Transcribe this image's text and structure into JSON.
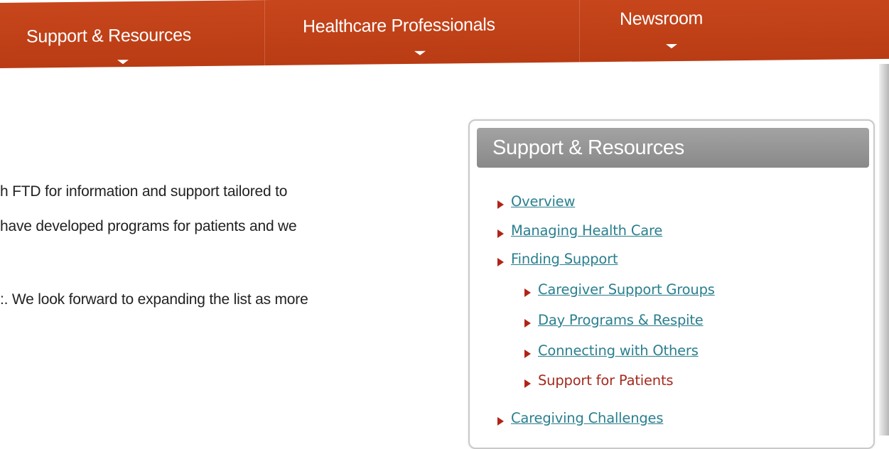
{
  "nav": {
    "items": [
      {
        "label": "Support & Resources"
      },
      {
        "label": "Healthcare Professionals"
      },
      {
        "label": "Newsroom"
      }
    ]
  },
  "content": {
    "lines": [
      "h FTD for information and support tailored to",
      "have developed programs for patients and we",
      ":.  We look forward to expanding the list as more"
    ]
  },
  "sidebar": {
    "title": "Support & Resources",
    "links": [
      {
        "label": "Overview"
      },
      {
        "label": "Managing Health Care"
      },
      {
        "label": "Finding Support"
      },
      {
        "label": "Caregiver Support Groups"
      },
      {
        "label": "Day Programs & Respite"
      },
      {
        "label": "Connecting with Others"
      },
      {
        "label": "Support for Patients"
      },
      {
        "label": "Caregiving Challenges"
      }
    ]
  },
  "colors": {
    "nav_background": "#c0421a",
    "link": "#2a7f8f",
    "current_link": "#a52a1e",
    "bullet": "#b02418",
    "panel_header": "#969696"
  }
}
